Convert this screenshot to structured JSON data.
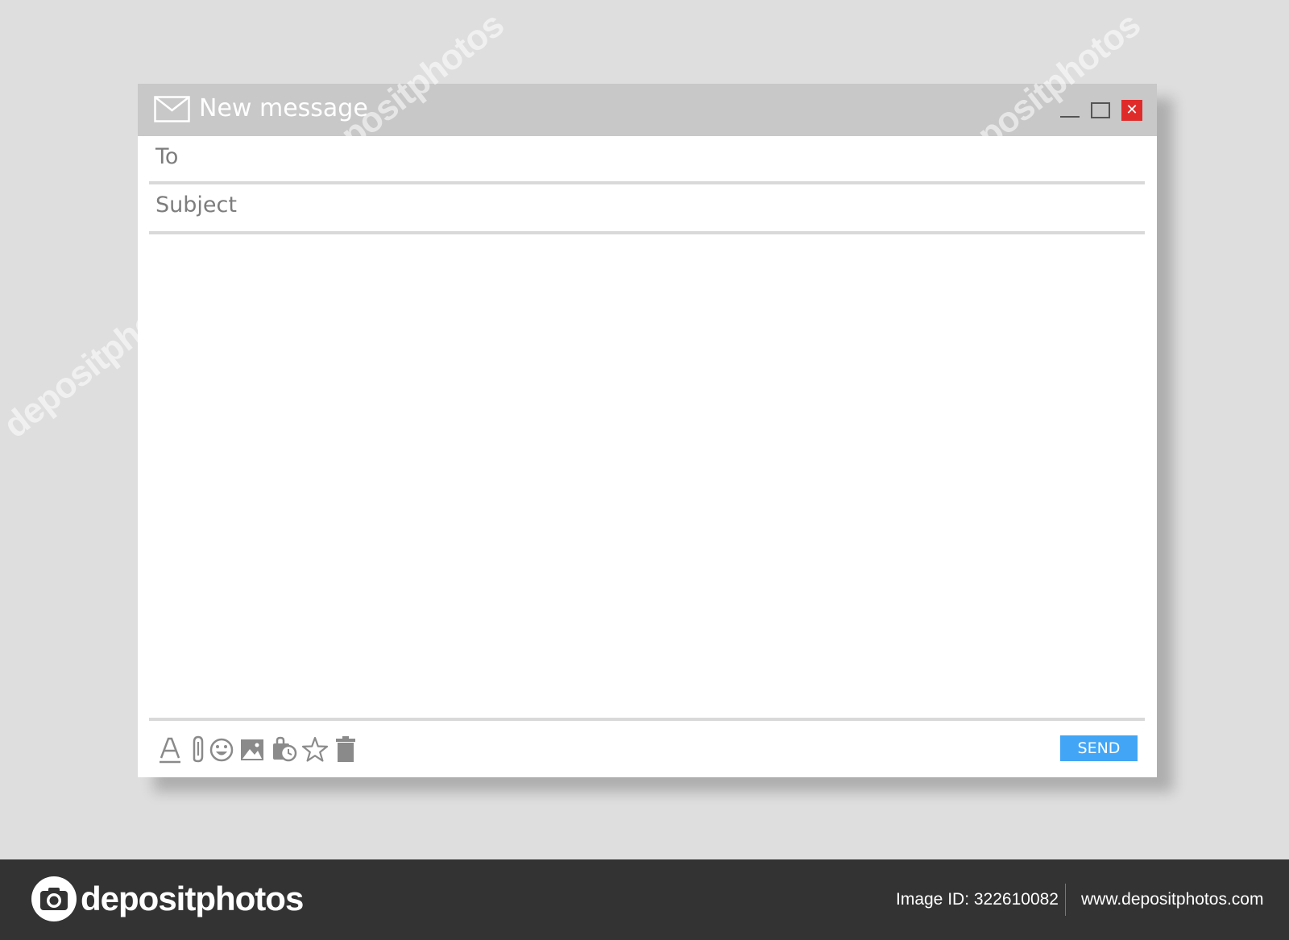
{
  "window": {
    "title": "New message",
    "controls": {
      "close_glyph": "✕"
    }
  },
  "compose": {
    "to_label": "To",
    "to_value": "",
    "subject_label": "Subject",
    "subject_value": "",
    "body_value": ""
  },
  "toolbar": {
    "icons": [
      "text-format-icon",
      "attachment-icon",
      "emoji-icon",
      "image-icon",
      "schedule-icon",
      "star-icon",
      "trash-icon"
    ],
    "send_label": "SEND"
  },
  "footer": {
    "brand": "depositphotos",
    "image_id": "Image ID: 322610082",
    "url": "www.depositphotos.com"
  },
  "watermark": "depositphotos",
  "colors": {
    "background": "#dedede",
    "titlebar": "#c8c8c8",
    "close_button": "#e02b2b",
    "send_button": "#42a5f5",
    "icon_gray": "#8a8a8a",
    "footer": "#333333"
  }
}
